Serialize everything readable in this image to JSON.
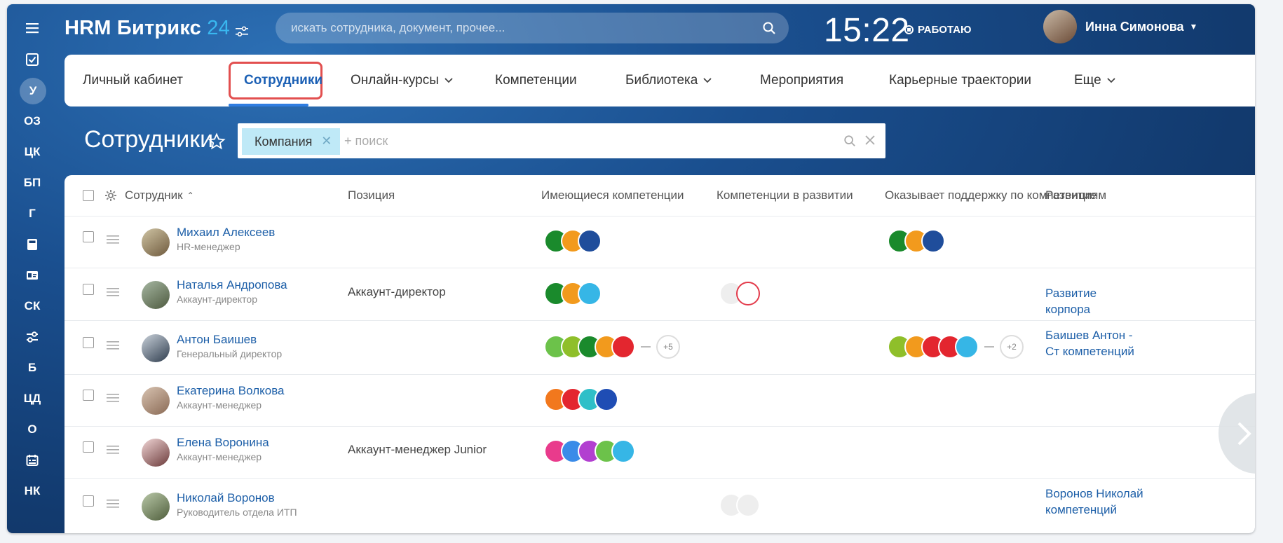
{
  "header": {
    "logo_main": "HRM Битрикс ",
    "logo_num": "24",
    "search_placeholder": "искать сотрудника, документ, прочее...",
    "clock": "15:22",
    "work_status": "РАБОТАЮ",
    "user_name": "Инна Симонова"
  },
  "rail": {
    "items": [
      {
        "label": "",
        "icon": "menu-icon"
      },
      {
        "label": "",
        "icon": "checkbox-icon"
      },
      {
        "label": "У",
        "active": true
      },
      {
        "label": "ОЗ"
      },
      {
        "label": "ЦК"
      },
      {
        "label": "БП"
      },
      {
        "label": "Г"
      },
      {
        "label": "",
        "icon": "calculator-icon"
      },
      {
        "label": "",
        "icon": "id-card-icon"
      },
      {
        "label": "СК"
      },
      {
        "label": "",
        "icon": "sliders-icon"
      },
      {
        "label": "Б"
      },
      {
        "label": "ЦД"
      },
      {
        "label": "О"
      },
      {
        "label": "",
        "icon": "calendar-icon"
      },
      {
        "label": "НК"
      }
    ]
  },
  "menu": {
    "items": [
      {
        "label": "Личный кабинет"
      },
      {
        "label": "Сотрудники",
        "active": true
      },
      {
        "label": "Онлайн-курсы",
        "dropdown": true
      },
      {
        "label": "Компетенции"
      },
      {
        "label": "Библиотека",
        "dropdown": true
      },
      {
        "label": "Мероприятия"
      },
      {
        "label": "Карьерные траектории"
      },
      {
        "label": "Еще",
        "dropdown": true
      }
    ]
  },
  "page": {
    "title": "Сотрудники",
    "filter_chip": "Компания",
    "filter_placeholder": "+ поиск"
  },
  "table": {
    "columns": [
      "Сотрудник",
      "Позиция",
      "Имеющиеся компетенции",
      "Компетенции в развитии",
      "Оказывает поддержку по компетенциям",
      "Развитие"
    ],
    "rows": [
      {
        "name": "Михаил Алексеев",
        "sub": "HR-менеджер",
        "position": "",
        "has": [
          "#1a8a2c",
          "#f29a1d",
          "#1f4d9b"
        ],
        "has_more": "",
        "dev": [],
        "support": [
          "#1a8a2c",
          "#f29a1d",
          "#1f4d9b"
        ],
        "support_more": "",
        "development": ""
      },
      {
        "name": "Наталья Андропова",
        "sub": "Аккаунт-директор",
        "position": "Аккаунт-директор",
        "has": [
          "#1a8a2c",
          "#f29a1d",
          "#36b6e6"
        ],
        "has_more": "",
        "dev": [
          "ghost",
          "ghost-red"
        ],
        "support": [],
        "support_more": "",
        "development": "Развитие корпора"
      },
      {
        "name": "Антон Баишев",
        "sub": "Генеральный директор",
        "position": "",
        "has": [
          "#6cc24a",
          "#8fbf2a",
          "#1a8a2c",
          "#f29a1d",
          "#e3262f"
        ],
        "has_more": "+5",
        "dev": [],
        "support": [
          "#8fbf2a",
          "#f29a1d",
          "#e3262f",
          "#e3262f",
          "#36b6e6"
        ],
        "support_more": "+2",
        "development": "Баишев Антон - Ст компетенций"
      },
      {
        "name": "Екатерина Волкова",
        "sub": "Аккаунт-менеджер",
        "position": "",
        "has": [
          "#f2781d",
          "#e3262f",
          "#2fbfc8",
          "#1f4db4"
        ],
        "has_more": "",
        "dev": [],
        "support": [],
        "support_more": "",
        "development": ""
      },
      {
        "name": "Елена Воронина",
        "sub": "Аккаунт-менеджер",
        "position": "Аккаунт-менеджер Junior",
        "has": [
          "#e93b8c",
          "#3a8be8",
          "#b23fd0",
          "#6cc24a",
          "#36b6e6"
        ],
        "has_more": "",
        "dev": [],
        "support": [],
        "support_more": "",
        "development": ""
      },
      {
        "name": "Николай Воронов",
        "sub": "Руководитель отдела ИТП",
        "position": "",
        "has": [],
        "has_more": "",
        "dev": [
          "ghost",
          "ghost"
        ],
        "support": [],
        "support_more": "",
        "development": "Воронов Николай компетенций"
      }
    ]
  }
}
